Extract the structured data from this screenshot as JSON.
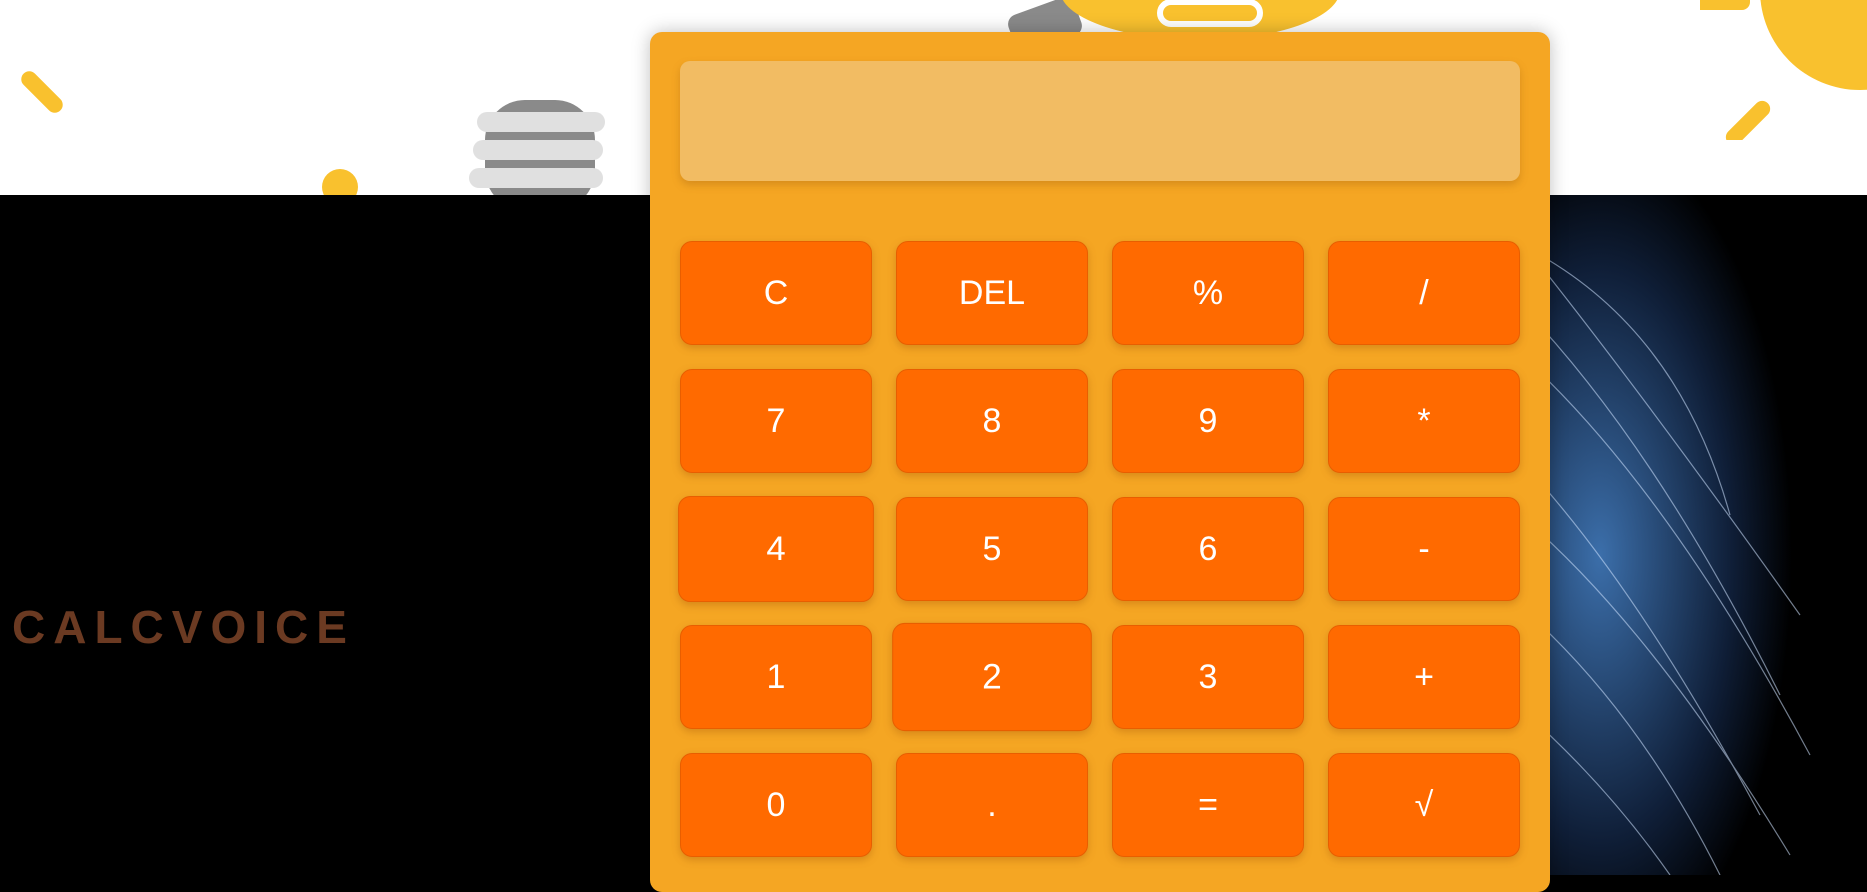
{
  "app": {
    "brand": "CALCVOICE"
  },
  "calculator": {
    "display_value": "",
    "keys": [
      {
        "label": "C",
        "name": "clear-button"
      },
      {
        "label": "DEL",
        "name": "delete-button"
      },
      {
        "label": "%",
        "name": "percent-button"
      },
      {
        "label": "/",
        "name": "divide-button"
      },
      {
        "label": "7",
        "name": "digit-7-button"
      },
      {
        "label": "8",
        "name": "digit-8-button"
      },
      {
        "label": "9",
        "name": "digit-9-button"
      },
      {
        "label": "*",
        "name": "multiply-button"
      },
      {
        "label": "4",
        "name": "digit-4-button"
      },
      {
        "label": "5",
        "name": "digit-5-button"
      },
      {
        "label": "6",
        "name": "digit-6-button"
      },
      {
        "label": "-",
        "name": "subtract-button"
      },
      {
        "label": "1",
        "name": "digit-1-button"
      },
      {
        "label": "2",
        "name": "digit-2-button"
      },
      {
        "label": "3",
        "name": "digit-3-button"
      },
      {
        "label": "+",
        "name": "add-button"
      },
      {
        "label": "0",
        "name": "digit-0-button"
      },
      {
        "label": ".",
        "name": "decimal-button"
      },
      {
        "label": "=",
        "name": "equals-button"
      },
      {
        "label": "√",
        "name": "sqrt-button"
      }
    ]
  },
  "colors": {
    "calculator_body": "#f5a623",
    "display": "#f2bc63",
    "key": "#ff6a00",
    "brand_text": "#6b3a22"
  },
  "icons": [
    "lightbulb-icon",
    "feather-graphic"
  ]
}
